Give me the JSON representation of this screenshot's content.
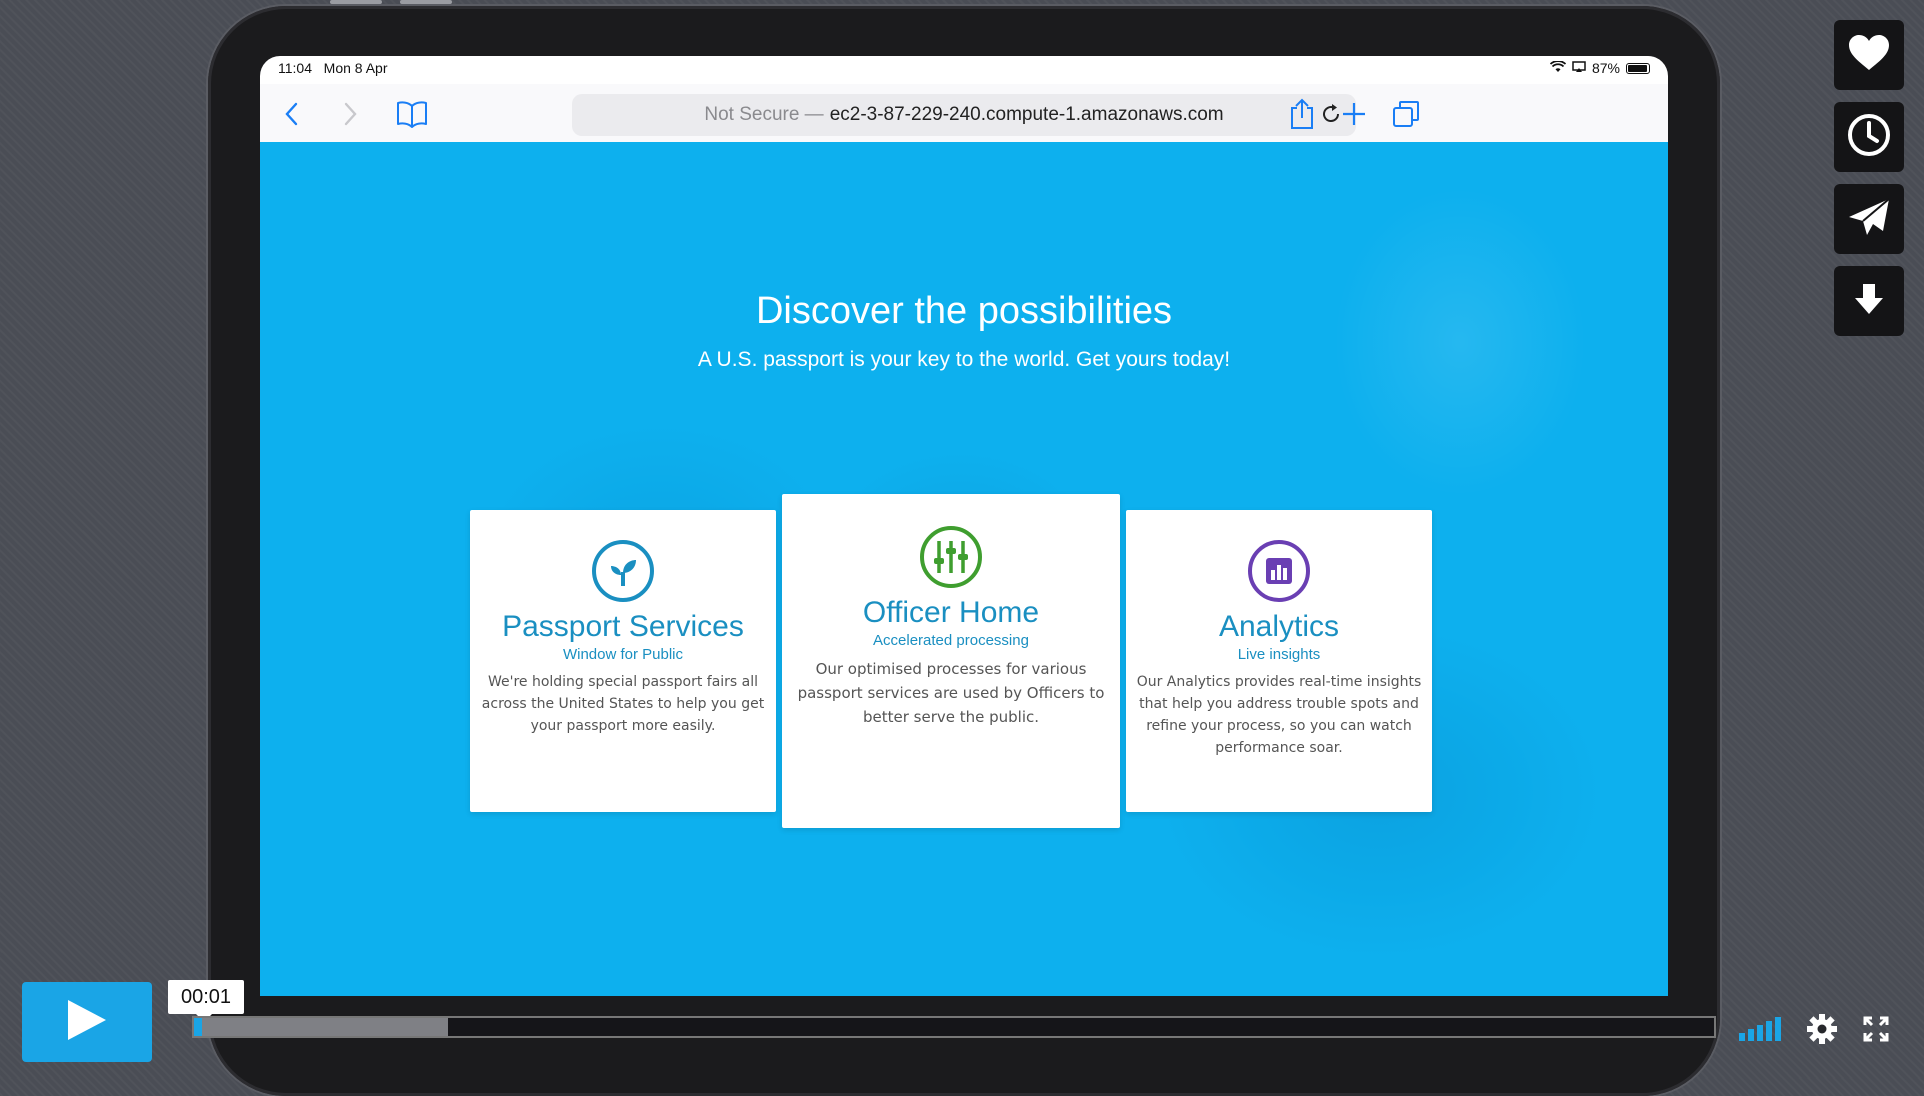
{
  "status": {
    "time": "11:04",
    "date": "Mon 8 Apr",
    "battery": "87%",
    "battery_level": 0.87
  },
  "toolbar": {
    "url_prefix": "Not Secure —",
    "url_host": "ec2-3-87-229-240.compute-1.amazonaws.com"
  },
  "hero": {
    "title": "Discover the possibilities",
    "subtitle": "A U.S. passport is your key to the world. Get yours today!"
  },
  "cards": [
    {
      "title": "Passport Services",
      "subtitle": "Window for Public",
      "body": "We're holding special passport fairs all across the United States to help you get your passport more easily.",
      "icon": "sprout-icon",
      "color": "#1a8fc1"
    },
    {
      "title": "Officer Home",
      "subtitle": "Accelerated processing",
      "body": "Our optimised processes for various passport services are used by Officers to better serve the public.",
      "icon": "sliders-icon",
      "color": "#3f9e2f"
    },
    {
      "title": "Analytics",
      "subtitle": "Live insights",
      "body": "Our Analytics provides real-time insights that help you address trouble spots and refine your process, so you can watch performance soar.",
      "icon": "bar-chart-icon",
      "color": "#6a3fb3"
    }
  ],
  "player": {
    "timecode": "00:01",
    "played_fraction": 0.003,
    "loaded_fraction": 0.167
  },
  "colors": {
    "page_bg": "#0db0ee",
    "player_accent": "#1aa5e6"
  }
}
